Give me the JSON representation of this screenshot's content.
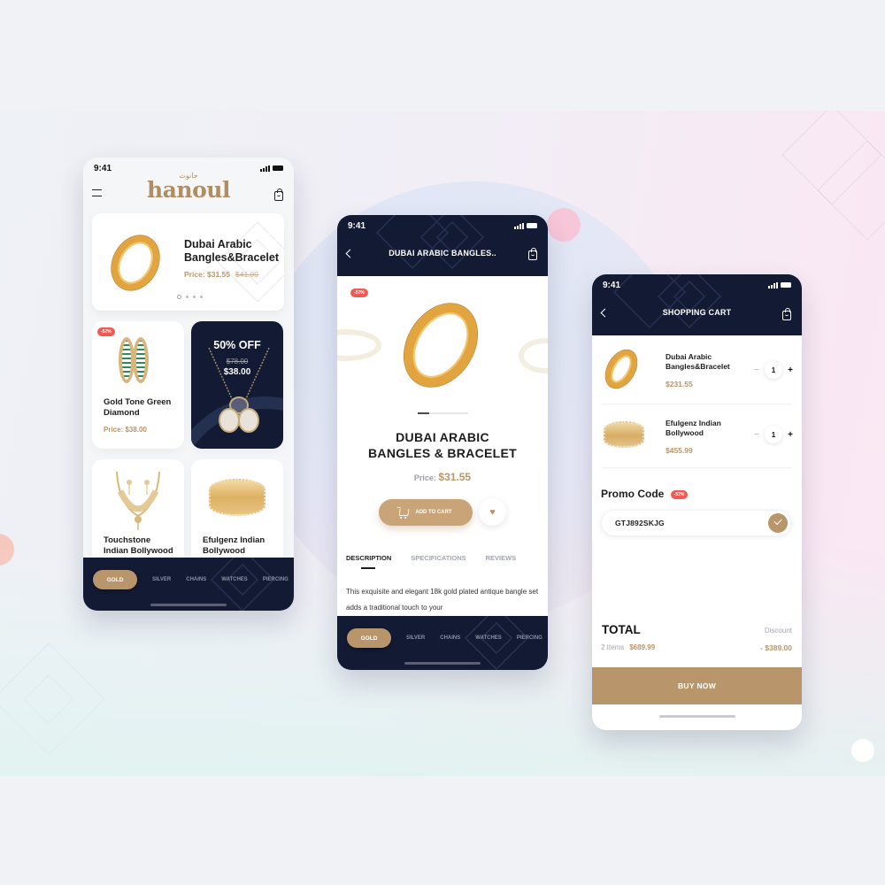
{
  "colors": {
    "brand_gold": "#b8956a",
    "navy": "#131a33",
    "badge_red": "#ef5a55"
  },
  "home_screen": {
    "status_time": "9:41",
    "logo_text": "hanoul",
    "logo_arabic": "حانوت",
    "icons": {
      "menu": "hamburger-menu-icon",
      "cart": "shopping-bag-icon"
    },
    "hero": {
      "title_line1": "Dubai Arabic",
      "title_line2": "Bangles&Bracelet",
      "price": "Price: $31.55",
      "old_price": "$41.00",
      "carousel_pages": 4,
      "carousel_active": 1
    },
    "tiles": [
      {
        "badge": "-52%",
        "title_line1": "Gold Tone Green",
        "title_line2": "Diamond",
        "price": "Price: $38.00"
      },
      {
        "offer": "50% OFF",
        "old_price": "$78.00",
        "price": "$38.00"
      },
      {
        "title_line1": "Touchstone",
        "title_line2": "Indian Bollywood"
      },
      {
        "title_line1": "Efulgenz Indian",
        "title_line2": "Bollywood"
      }
    ],
    "categories": [
      "GOLD",
      "SILVER",
      "CHAINS",
      "WATCHES",
      "PIERCING"
    ],
    "active_category": "GOLD"
  },
  "product_screen": {
    "status_time": "9:41",
    "nav_title": "DUBAI ARABIC BANGLES..",
    "badge": "-52%",
    "title_line1": "DUBAI ARABIC",
    "title_line2": "BANGLES & BRACELET",
    "price_label": "Price:",
    "price": "$31.55",
    "add_to_cart": "ADD TO CART",
    "heart_glyph": "♥",
    "tabs": [
      "DESCRIPTION",
      "SPECIFICATIONS",
      "REVIEWS"
    ],
    "active_tab": "DESCRIPTION",
    "description": "This exquisite and elegant 18k gold plated antique bangle set adds a traditional touch to your",
    "categories": [
      "GOLD",
      "SILVER",
      "CHAINS",
      "WATCHES",
      "PIERCING"
    ],
    "active_category": "GOLD"
  },
  "cart_screen": {
    "status_time": "9:41",
    "nav_title": "SHOPPING CART",
    "items": [
      {
        "title_line1": "Dubai Arabic",
        "title_line2": "Bangles&Bracelet",
        "price": "$231.55",
        "qty": "1"
      },
      {
        "title_line1": "Efulgenz Indian",
        "title_line2": "Bollywood",
        "price": "$455.99",
        "qty": "1"
      }
    ],
    "qty_minus": "−",
    "qty_plus": "+",
    "promo_label": "Promo Code",
    "promo_badge": "-52%",
    "promo_value": "GTJ892SKJG",
    "total_label": "TOTAL",
    "items_count": "2 Items",
    "total_value": "$689.99",
    "discount_label": "Discount",
    "discount_value": "- $389.00",
    "buy_now": "BUY NOW"
  }
}
